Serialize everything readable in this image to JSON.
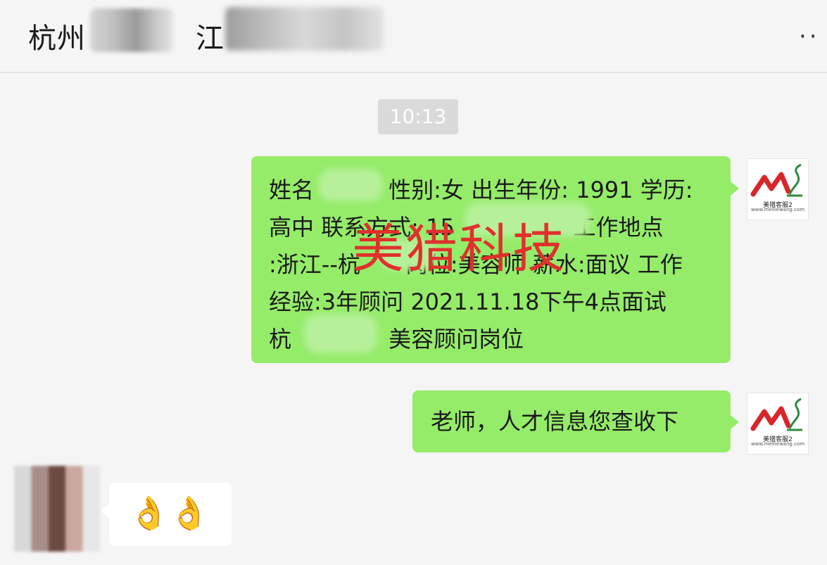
{
  "header": {
    "title_prefix": "杭州",
    "title_second": "江",
    "more_label": "··"
  },
  "timestamp": "10:13",
  "messages": [
    {
      "lines": [
        "姓名　　　 性别:女 出生年份: 1991 学历:",
        "高中 联系方式: 15　　　　 7 工作地点",
        ":浙江--杭　　岗位:美容师 薪水:面议 工作",
        "经验:3年顾问 2021.11.18下午4点面试",
        "杭　　　　 美容顾问岗位"
      ]
    },
    {
      "text": "老师，人才信息您查收下"
    },
    {
      "emoji": "👌👌"
    }
  ],
  "watermark": "美猎科技",
  "avatar_logo": {
    "text1": "美猎客服2",
    "text2": "www.meiliewang.com"
  },
  "colors": {
    "sent_bubble": "#95ec69",
    "received_bubble": "#ffffff",
    "watermark": "#e0302d",
    "background": "#f5f5f5"
  }
}
